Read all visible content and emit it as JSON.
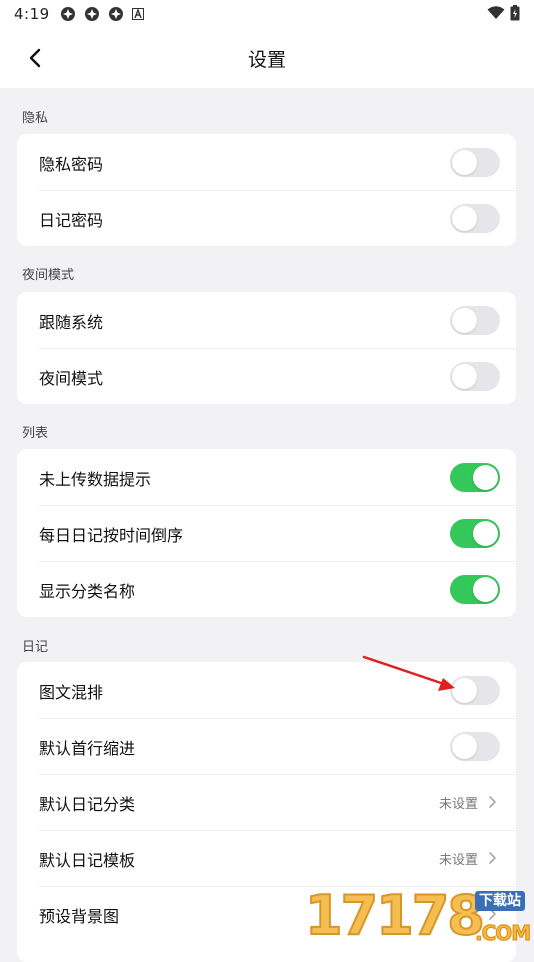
{
  "status_bar": {
    "time": "4:19",
    "notification_icons": [
      "app-notification-icon",
      "app-notification-icon",
      "app-notification-icon",
      "a-icon"
    ],
    "right_icons": [
      "wifi-icon",
      "battery-charging-icon"
    ]
  },
  "header": {
    "title": "设置"
  },
  "sections": [
    {
      "title": "隐私",
      "rows": [
        {
          "label": "隐私密码",
          "type": "toggle",
          "on": false
        },
        {
          "label": "日记密码",
          "type": "toggle",
          "on": false
        }
      ]
    },
    {
      "title": "夜间模式",
      "rows": [
        {
          "label": "跟随系统",
          "type": "toggle",
          "on": false
        },
        {
          "label": "夜间模式",
          "type": "toggle",
          "on": false
        }
      ]
    },
    {
      "title": "列表",
      "rows": [
        {
          "label": "未上传数据提示",
          "type": "toggle",
          "on": true
        },
        {
          "label": "每日日记按时间倒序",
          "type": "toggle",
          "on": true
        },
        {
          "label": "显示分类名称",
          "type": "toggle",
          "on": true
        }
      ]
    },
    {
      "title": "日记",
      "rows": [
        {
          "label": "图文混排",
          "type": "toggle",
          "on": false
        },
        {
          "label": "默认首行缩进",
          "type": "toggle",
          "on": false
        },
        {
          "label": "默认日记分类",
          "type": "select",
          "value": "未设置"
        },
        {
          "label": "默认日记模板",
          "type": "select",
          "value": "未设置"
        },
        {
          "label": "预设背景图",
          "type": "select",
          "value": ""
        }
      ]
    }
  ],
  "watermark": {
    "number": "17178",
    "badge": "下载站",
    "domain": ".COM"
  },
  "colors": {
    "toggle_on": "#34c759",
    "toggle_off": "#e6e6ea",
    "annotation_arrow": "#e02020",
    "background": "#f2f2f4"
  }
}
